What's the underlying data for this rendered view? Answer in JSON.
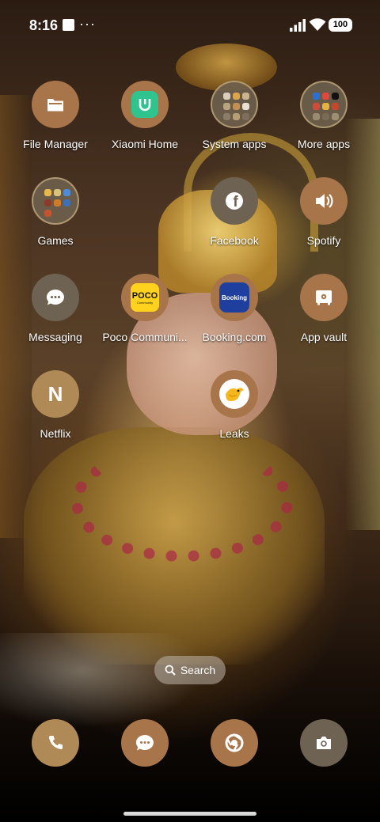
{
  "status_bar": {
    "time": "8:16",
    "more": "···",
    "battery": "100"
  },
  "apps": [
    {
      "label": "File Manager",
      "icon": "folder-icon",
      "color": "#a8754a"
    },
    {
      "label": "Xiaomi Home",
      "icon": "mi-home-icon",
      "color": "#a8754a"
    },
    {
      "label": "System apps",
      "icon": "folder-grid-icon"
    },
    {
      "label": "More apps",
      "icon": "folder-grid-icon"
    },
    {
      "label": "Games",
      "icon": "folder-grid-icon"
    },
    {
      "label": "Facebook",
      "icon": "facebook-icon",
      "color": "#6e6253"
    },
    {
      "label": "Spotify",
      "icon": "speaker-icon",
      "color": "#a8754a"
    },
    {
      "label": "Messaging",
      "icon": "message-bubble-icon",
      "color": "#6e6253"
    },
    {
      "label": "Poco Communi...",
      "icon": "poco-icon",
      "logo_text": "POCO",
      "sub_text": "Community",
      "color": "#ffd21e"
    },
    {
      "label": "Booking.com",
      "icon": "booking-icon",
      "logo_text": "Booking",
      "color": "#1f3f9e"
    },
    {
      "label": "App vault",
      "icon": "vault-icon",
      "color": "#a8754a"
    },
    {
      "label": "Netflix",
      "icon": "netflix-n-icon",
      "logo_text": "N",
      "color": "#b08a56"
    },
    {
      "label": "Leaks",
      "icon": "bird-icon",
      "color": "#a8754a"
    }
  ],
  "search": {
    "label": "Search"
  },
  "dock": [
    {
      "name": "phone",
      "icon": "phone-icon",
      "color": "#b08a56"
    },
    {
      "name": "messages",
      "icon": "chat-bubble-icon",
      "color": "#a8754a"
    },
    {
      "name": "chrome",
      "icon": "chrome-icon",
      "color": "#a8754a"
    },
    {
      "name": "camera",
      "icon": "camera-icon",
      "color": "#6e6253"
    }
  ]
}
